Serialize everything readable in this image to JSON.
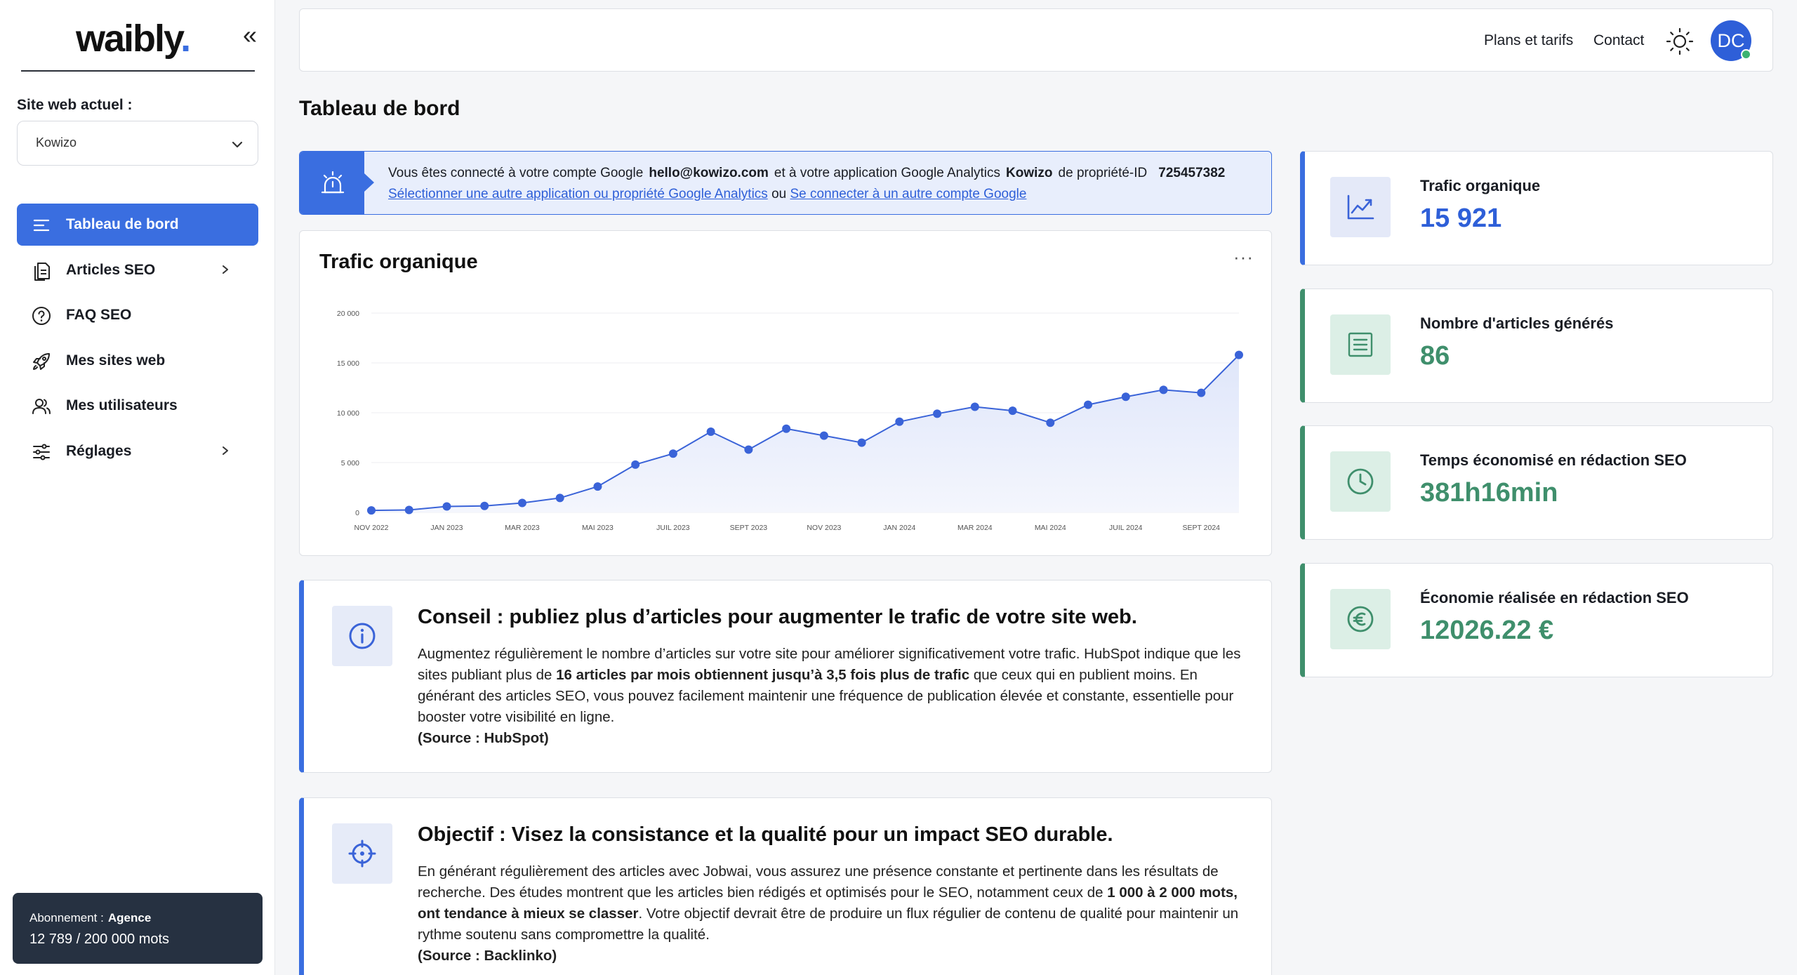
{
  "brand": {
    "name": "waibly",
    "dot": "."
  },
  "sidebar": {
    "site_label": "Site web actuel :",
    "site_value": "Kowizo",
    "items": [
      {
        "label": "Tableau de bord",
        "icon": "dashboard-icon"
      },
      {
        "label": "Articles SEO",
        "icon": "document-icon"
      },
      {
        "label": "FAQ SEO",
        "icon": "question-icon"
      },
      {
        "label": "Mes sites web",
        "icon": "rocket-icon"
      },
      {
        "label": "Mes utilisateurs",
        "icon": "users-icon"
      },
      {
        "label": "Réglages",
        "icon": "sliders-icon"
      }
    ],
    "subscription": {
      "label": "Abonnement :",
      "plan": "Agence",
      "usage": "12 789 / 200 000 mots"
    }
  },
  "topbar": {
    "pricing": "Plans et tarifs",
    "contact": "Contact",
    "avatar": "DC"
  },
  "page_title": "Tableau de bord",
  "notice": {
    "t1": "Vous êtes connecté à votre compte Google",
    "email": "hello@kowizo.com",
    "t2": "et à votre application Google Analytics",
    "app": "Kowizo",
    "t3": "de propriété-ID",
    "id": "725457382",
    "link1": "Sélectionner une autre application ou propriété Google Analytics",
    "or": "ou",
    "link2": "Se connecter à un autre compte Google"
  },
  "chart_card": {
    "title": "Trafic organique",
    "more": "···"
  },
  "chart_data": {
    "type": "area",
    "title": "Trafic organique",
    "x_tick_labels": [
      "NOV 2022",
      "JAN 2023",
      "MAR 2023",
      "MAI 2023",
      "JUIL 2023",
      "SEPT 2023",
      "NOV 2023",
      "JAN 2024",
      "MAR 2024",
      "MAI 2024",
      "JUIL 2024",
      "SEPT 2024"
    ],
    "y_tick_labels": [
      "0",
      "5 000",
      "10 000",
      "15 000",
      "20 000"
    ],
    "ylim": [
      0,
      20000
    ],
    "x": [
      "NOV 2022",
      "DÉC 2022",
      "JAN 2023",
      "FÉV 2023",
      "MAR 2023",
      "AVR 2023",
      "MAI 2023",
      "JUIN 2023",
      "JUIL 2023",
      "AOÛT 2023",
      "SEPT 2023",
      "OCT 2023",
      "NOV 2023",
      "DÉC 2023",
      "JAN 2024",
      "FÉV 2024",
      "MAR 2024",
      "AVR 2024",
      "MAI 2024",
      "JUIN 2024",
      "JUIL 2024",
      "AOÛT 2024",
      "SEPT 2024",
      "OCT 2024"
    ],
    "values": [
      200,
      250,
      600,
      650,
      950,
      1450,
      2600,
      4800,
      5900,
      8100,
      6300,
      8400,
      7700,
      7000,
      9100,
      9900,
      10600,
      10200,
      9000,
      10800,
      11600,
      12300,
      12000,
      15800
    ],
    "grid": true,
    "colors": {
      "line": "#3a63d8",
      "fill": "#dfe6fa"
    }
  },
  "tips": [
    {
      "title": "Conseil : publiez plus d’articles pour augmenter le trafic de votre site web.",
      "body_a": "Augmentez régulièrement le nombre d’articles sur votre site pour améliorer significativement votre trafic. HubSpot indique que les sites publiant plus de ",
      "body_b": "16 articles par mois obtiennent jusqu’à 3,5 fois plus de trafic",
      "body_c": " que ceux qui en publient moins. En générant des articles SEO, vous pouvez facilement maintenir une fréquence de publication élevée et constante, essentielle pour booster votre visibilité en ligne.",
      "source": "(Source : HubSpot)"
    },
    {
      "title": "Objectif : Visez la consistance et la qualité pour un impact SEO durable.",
      "body_a": "En générant régulièrement des articles avec Jobwai, vous assurez une présence constante et pertinente dans les résultats de recherche. Des études montrent que les articles bien rédigés et optimisés pour le SEO, notamment ceux de ",
      "body_b": "1 000 à 2 000 mots, ont tendance à mieux se classer",
      "body_c": ". Votre objectif devrait être de produire un flux régulier de contenu de qualité pour maintenir un rythme soutenu sans compromettre la qualité.",
      "source": "(Source : Backlinko)"
    }
  ],
  "stats": [
    {
      "label": "Trafic organique",
      "value": "15 921",
      "icon": "trend-chart-icon"
    },
    {
      "label": "Nombre d'articles générés",
      "value": "86",
      "icon": "article-icon"
    },
    {
      "label": "Temps économisé en rédaction SEO",
      "value": "381h16min",
      "icon": "clock-icon"
    },
    {
      "label": "Économie réalisée en rédaction SEO",
      "value": "12026.22 €",
      "icon": "euro-icon"
    }
  ]
}
